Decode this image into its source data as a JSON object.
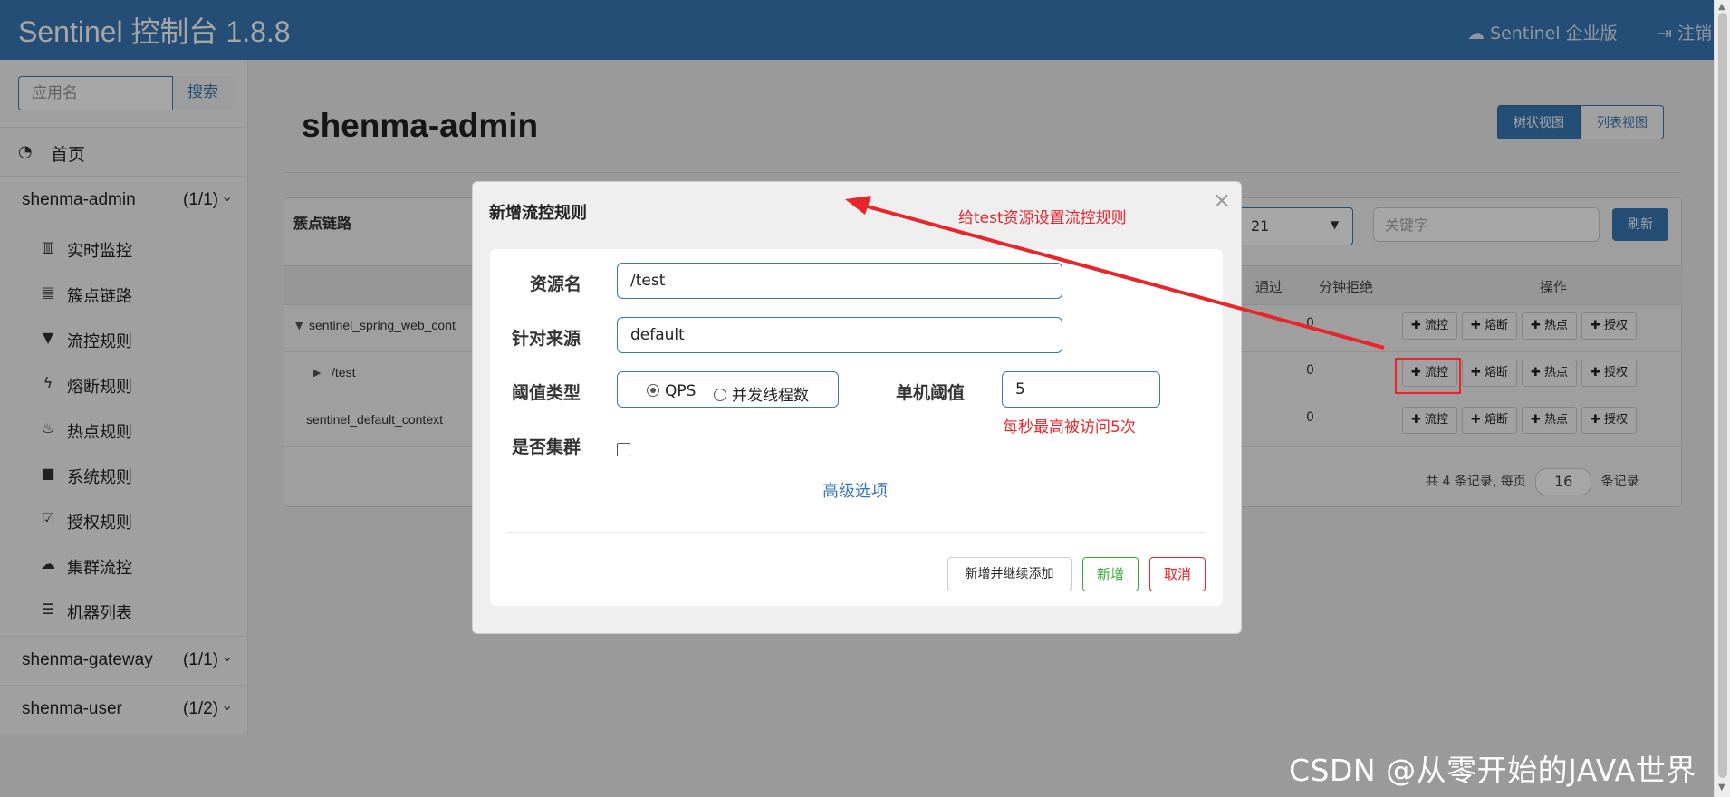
{
  "header": {
    "title": "Sentinel 控制台 1.8.8",
    "enterprise_label": "Sentinel 企业版",
    "logout_label": "注销"
  },
  "sidebar": {
    "search_placeholder": "应用名",
    "search_button": "搜索",
    "home_label": "首页",
    "apps": [
      {
        "name": "shenma-admin",
        "count": "(1/1)"
      },
      {
        "name": "shenma-gateway",
        "count": "(1/1)"
      },
      {
        "name": "shenma-user",
        "count": "(1/2)"
      }
    ],
    "submenu": [
      {
        "label": "实时监控",
        "icon": "bar-chart-icon"
      },
      {
        "label": "簇点链路",
        "icon": "list-icon"
      },
      {
        "label": "流控规则",
        "icon": "filter-icon"
      },
      {
        "label": "熔断规则",
        "icon": "flash-icon"
      },
      {
        "label": "热点规则",
        "icon": "fire-icon"
      },
      {
        "label": "系统规则",
        "icon": "lock-icon"
      },
      {
        "label": "授权规则",
        "icon": "check-icon"
      },
      {
        "label": "集群流控",
        "icon": "cloud-icon"
      },
      {
        "label": "机器列表",
        "icon": "th-list-icon"
      }
    ]
  },
  "main": {
    "title": "shenma-admin",
    "view_tree": "树状视图",
    "view_list": "列表视图",
    "panel_title": "簇点链路",
    "machine_select_value": "21",
    "keyword_placeholder": "关键字",
    "refresh_label": "刷新",
    "columns": {
      "passed_partial": "通过",
      "rejected_per_min": "分钟拒绝",
      "ops": "操作"
    },
    "rows": [
      {
        "name": "sentinel_spring_web_cont",
        "rejected": "0",
        "expanded": true
      },
      {
        "name": "/test",
        "rejected": "0",
        "expanded": false
      },
      {
        "name": "sentinel_default_context",
        "rejected": "0"
      }
    ],
    "op_labels": {
      "flow": "✚ 流控",
      "degrade": "✚ 熔断",
      "hot": "✚ 热点",
      "auth": "✚ 授权"
    },
    "pager": {
      "prefix": "共 4 条记录, 每页",
      "page_size": "16",
      "suffix": "条记录"
    }
  },
  "modal": {
    "title": "新增流控规则",
    "close": "×",
    "resource_label": "资源名",
    "resource_value": "/test",
    "limit_app_label": "针对来源",
    "limit_app_value": "default",
    "grade_label": "阈值类型",
    "grade_options": [
      "QPS",
      "并发线程数"
    ],
    "grade_selected": "QPS",
    "count_label": "单机阈值",
    "count_value": "5",
    "cluster_label": "是否集群",
    "cluster_checked": false,
    "advanced_label": "高级选项",
    "btn_add_continue": "新增并继续添加",
    "btn_add": "新增",
    "btn_cancel": "取消"
  },
  "annotations": {
    "arrow_note": "给test资源设置流控规则",
    "count_note": "每秒最高被访问5次"
  },
  "watermark": "CSDN @从零开始的JAVA世界",
  "colors": {
    "primary": "#3879b4",
    "danger": "#e8252b",
    "success": "#3aaa3a"
  }
}
